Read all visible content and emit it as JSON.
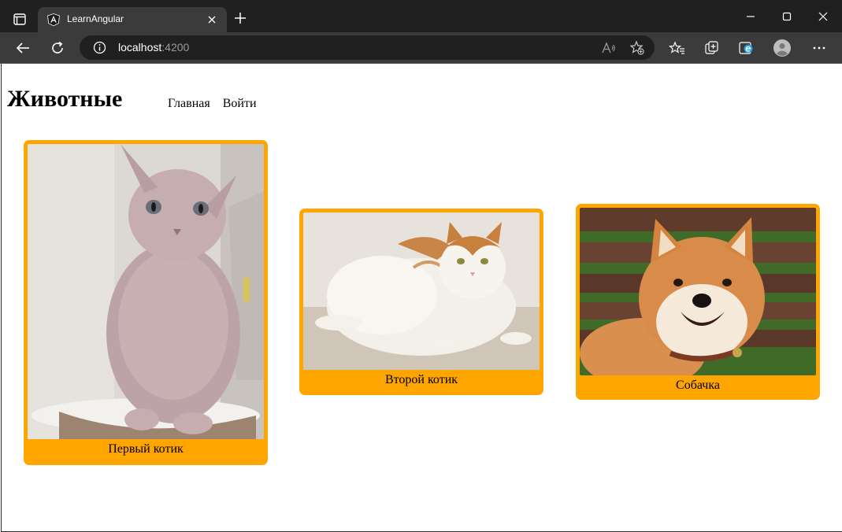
{
  "browser": {
    "tab_title": "LearnAngular",
    "address_host": "localhost",
    "address_port": ":4200"
  },
  "site": {
    "title": "Животные",
    "nav": [
      "Главная",
      "Войти"
    ]
  },
  "cards": [
    {
      "caption": "Первый котик",
      "image": "sphynx-cat-photo"
    },
    {
      "caption": "Второй котик",
      "image": "fat-white-ginger-cat-photo"
    },
    {
      "caption": "Собачка",
      "image": "shiba-inu-dog-photo"
    }
  ],
  "colors": {
    "card_background": "#ffa500",
    "browser_chrome": "#202020",
    "browser_toolbar": "#3b3b3b"
  }
}
